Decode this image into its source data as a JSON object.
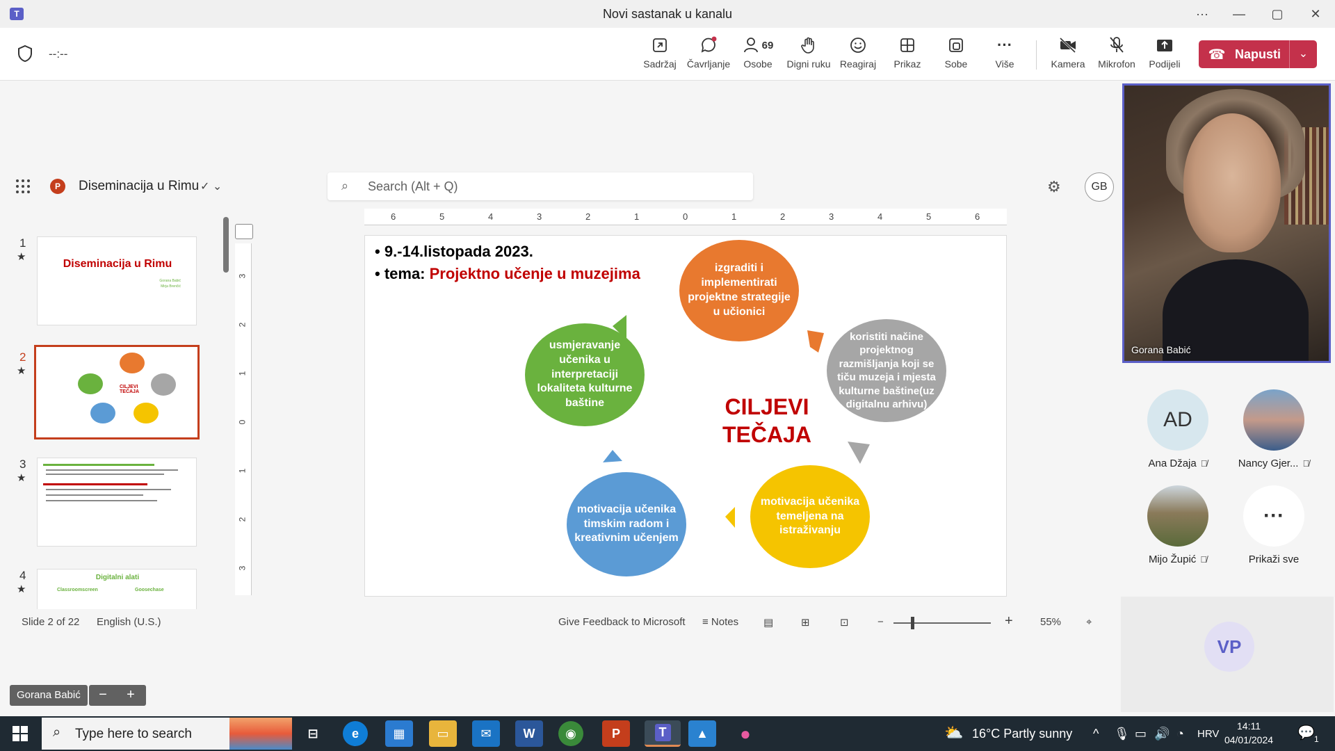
{
  "window": {
    "title": "Novi sastanak u kanalu",
    "controls": [
      "···",
      "—",
      "▢",
      "✕"
    ]
  },
  "meeting": {
    "timer": "--:--",
    "participants_count": "69",
    "buttons": {
      "content": "Sadržaj",
      "chat": "Čavrljanje",
      "people": "Osobe",
      "raise_hand": "Digni ruku",
      "react": "Reagiraj",
      "view": "Prikaz",
      "rooms": "Sobe",
      "more": "Više",
      "camera": "Kamera",
      "mic": "Mikrofon",
      "share": "Podijeli",
      "leave": "Napusti"
    }
  },
  "ppt": {
    "doc_name": "Diseminacija u Rimu",
    "search_placeholder": "Search (Alt + Q)",
    "user_initials": "GB",
    "slides": [
      {
        "num": "1",
        "title": "Diseminacija u Rimu",
        "subtitle1": "Gorana Babić",
        "subtitle2": "Mirja Brenčić"
      },
      {
        "num": "2"
      },
      {
        "num": "3"
      },
      {
        "num": "4",
        "title": "Digitalni alati",
        "col1": "Classroomscreen",
        "col2": "Goosechase"
      }
    ],
    "hruler": [
      "6",
      "5",
      "4",
      "3",
      "2",
      "1",
      "0",
      "1",
      "2",
      "3",
      "4",
      "5",
      "6"
    ],
    "vruler": [
      "3",
      "2",
      "1",
      "0",
      "1",
      "2",
      "3"
    ],
    "current_slide": {
      "bullet1": "9.-14.listopada 2023.",
      "bullet2_prefix": "tema: ",
      "bullet2_highlight": "Projektno učenje u muzejima",
      "center_line1": "CILJEVI",
      "center_line2": "TEČAJA",
      "circle_top": "izgraditi i implementirati projektne strategije u učionici",
      "circle_right": "koristiti načine projektnog razmišljanja koji se tiču muzeja i mjesta kulturne baštine(uz digitalnu arhivu)",
      "circle_bottom_right": "motivacija učenika temeljena na istraživanju",
      "circle_bottom_left": "motivacija učenika timskim radom i kreativnim učenjem",
      "circle_left": "usmjeravanje učenika u interpretaciji lokaliteta kulturne baštine",
      "colors": {
        "orange": "#e8792f",
        "gray": "#a6a6a6",
        "yellow": "#f5c400",
        "blue": "#5b9bd5",
        "green": "#6ab23e"
      }
    },
    "status": {
      "slide_info": "Slide 2 of 22",
      "language": "English (U.S.)",
      "feedback": "Give Feedback to Microsoft",
      "notes": "Notes",
      "zoom": "55%"
    }
  },
  "presenter_badge": "Gorana Babić",
  "participants": {
    "main_video_name": "Gorana Babić",
    "tiles": [
      {
        "initials": "AD",
        "name": "Ana Džaja"
      },
      {
        "name": "Nancy Gjer..."
      },
      {
        "name": "Mijo Župić"
      },
      {
        "name": "Prikaži sve"
      }
    ],
    "vp_initials": "VP"
  },
  "taskbar": {
    "search_placeholder": "Type here to search",
    "weather": "16°C  Partly sunny",
    "lang": "HRV",
    "time": "14:11",
    "date": "04/01/2024",
    "notifications": "1"
  }
}
